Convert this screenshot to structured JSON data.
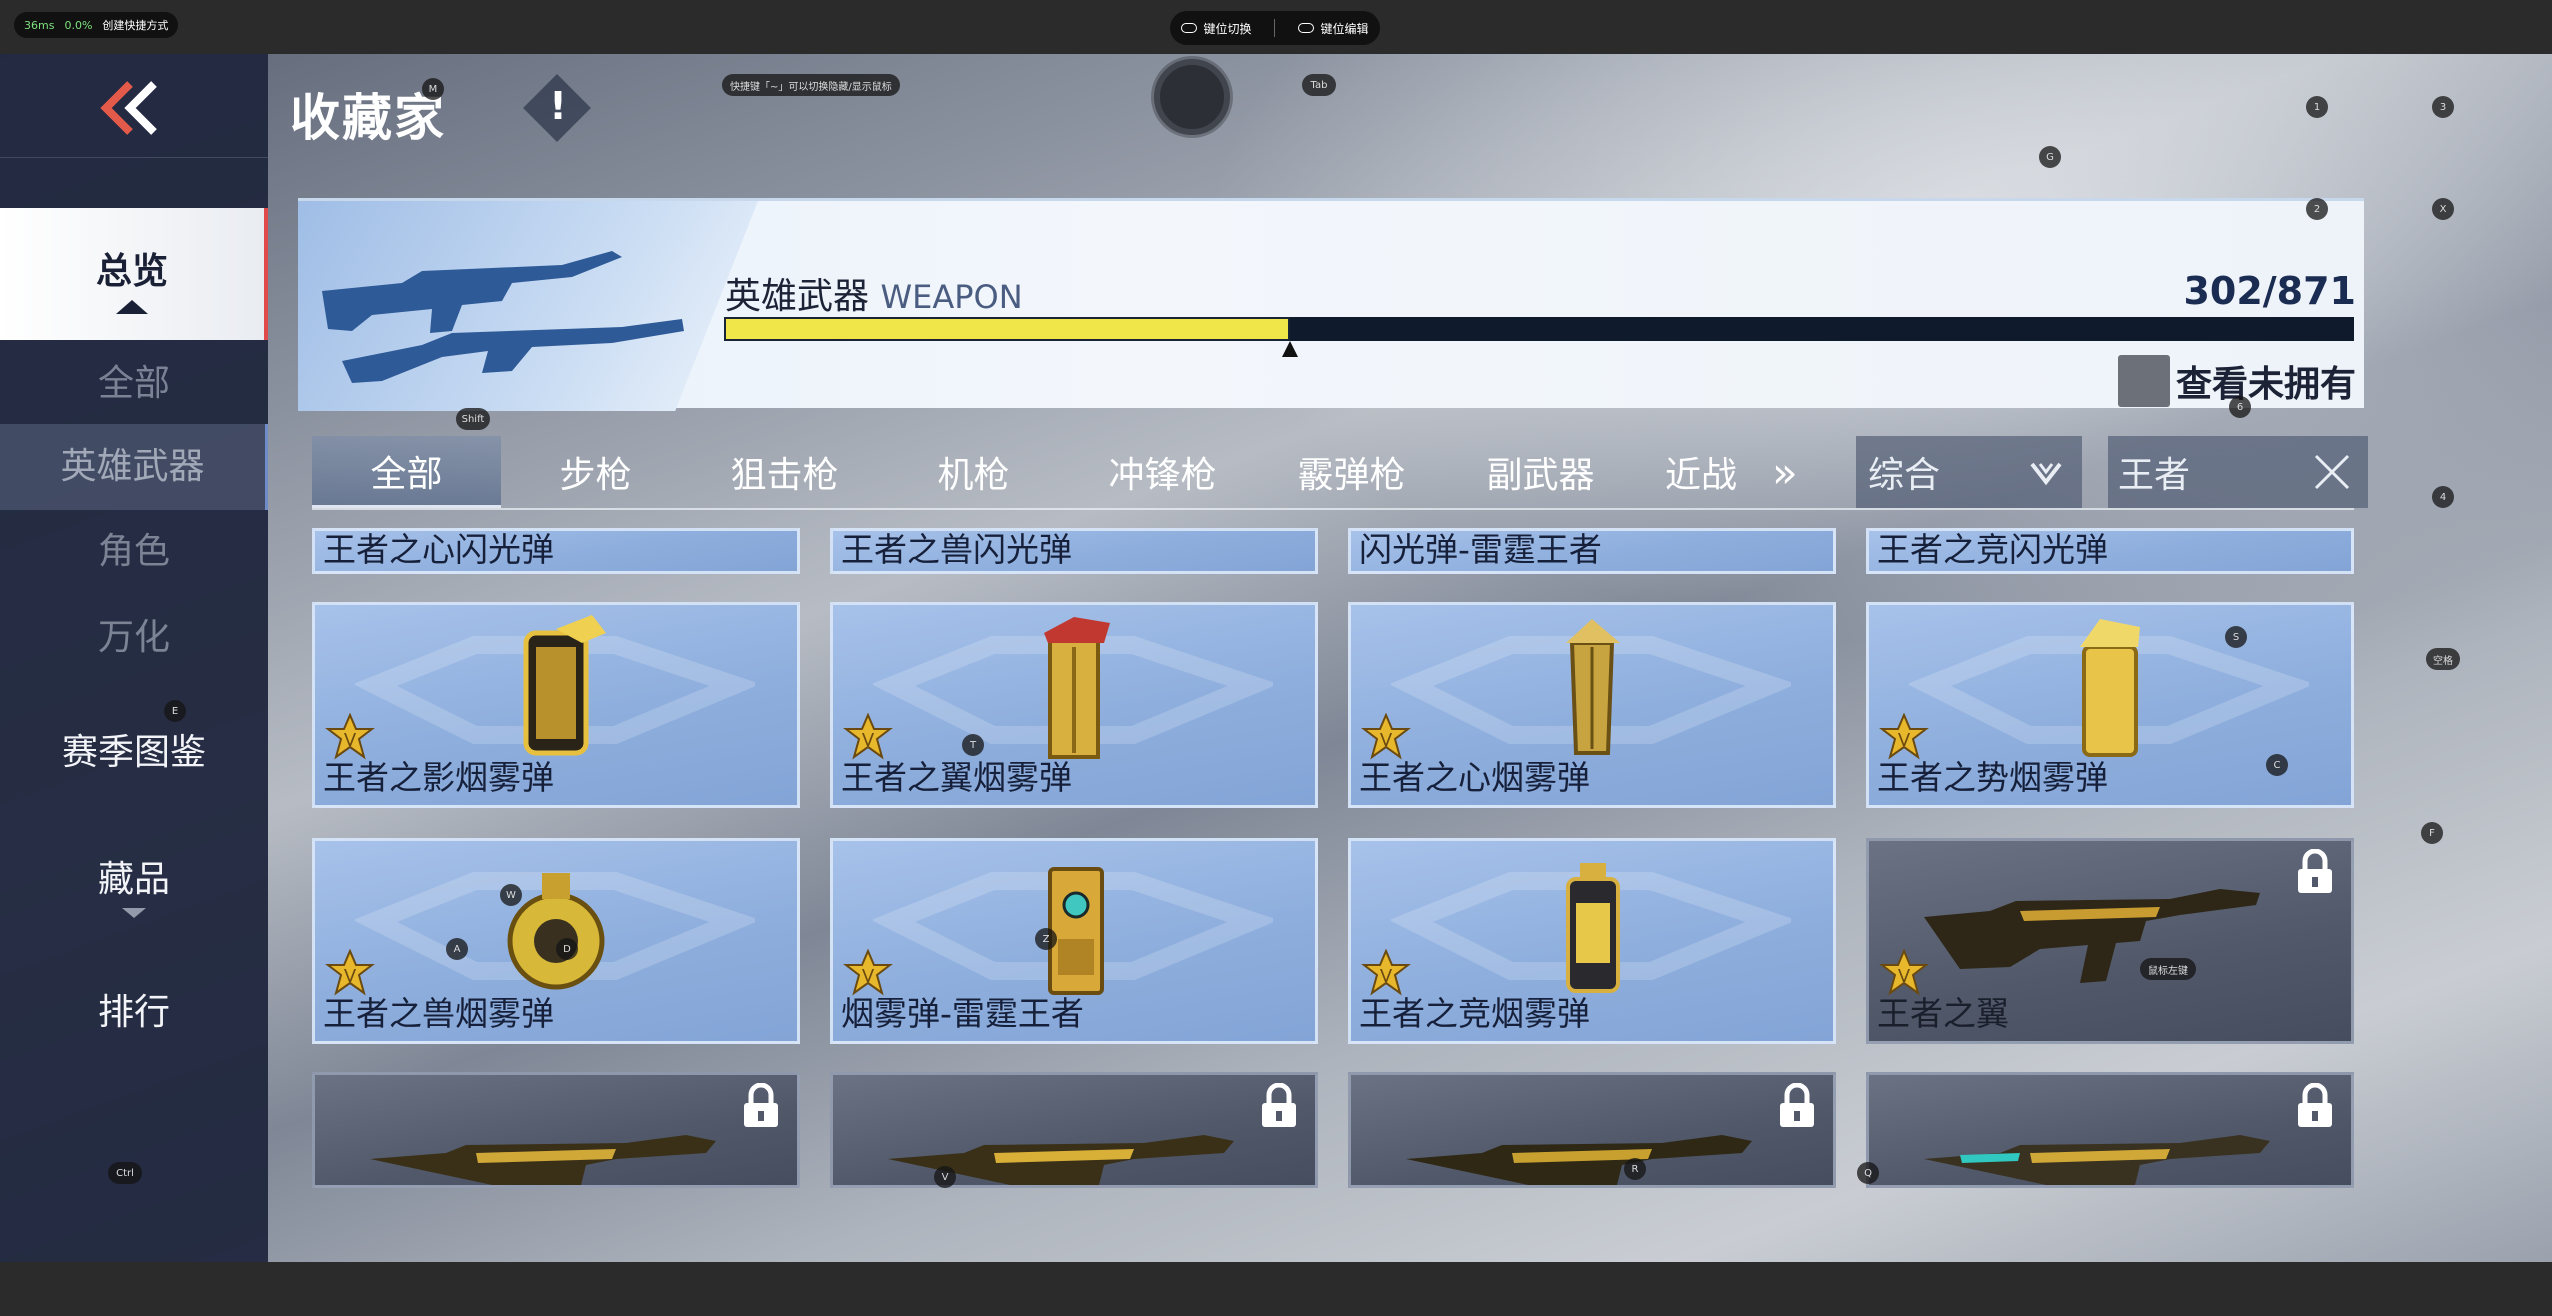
{
  "emulator": {
    "fps_ms": "36ms",
    "cpu": "0.0%",
    "shortcut_label": "创建快捷方式",
    "key_switch": "键位切换",
    "key_edit": "键位编辑"
  },
  "header": {
    "title": "收藏家",
    "info_symbol": "!",
    "hint_text": "快捷键「~」可以切换隐藏/显示鼠标"
  },
  "sidebar": {
    "items": [
      {
        "label": "总览",
        "state": "active"
      },
      {
        "label": "全部",
        "state": "sub"
      },
      {
        "label": "英雄武器",
        "state": "selected"
      },
      {
        "label": "角色",
        "state": "sub"
      },
      {
        "label": "万化",
        "state": "sub"
      },
      {
        "label": "赛季图鉴",
        "state": "normal"
      },
      {
        "label": "藏品",
        "state": "normal"
      },
      {
        "label": "排行",
        "state": "normal"
      }
    ]
  },
  "banner": {
    "label_cn": "英雄武器",
    "label_en": "WEAPON",
    "count": "302/871",
    "progress": 0.347,
    "unowned_label": "查看未拥有"
  },
  "tabs": {
    "items": [
      "全部",
      "步枪",
      "狙击枪",
      "机枪",
      "冲锋枪",
      "霰弹枪",
      "副武器",
      "近战"
    ],
    "active_index": 0,
    "more_symbol": "»"
  },
  "filter": {
    "sort_value": "综合",
    "search_value": "王者"
  },
  "grid": {
    "top_row": [
      "王者之心闪光弹",
      "王者之兽闪光弹",
      "闪光弹-雷霆王者",
      "王者之竞闪光弹"
    ],
    "row1": [
      {
        "name": "王者之影烟雾弹",
        "locked": false
      },
      {
        "name": "王者之翼烟雾弹",
        "locked": false
      },
      {
        "name": "王者之心烟雾弹",
        "locked": false
      },
      {
        "name": "王者之势烟雾弹",
        "locked": false
      }
    ],
    "row2": [
      {
        "name": "王者之兽烟雾弹",
        "locked": false
      },
      {
        "name": "烟雾弹-雷霆王者",
        "locked": false
      },
      {
        "name": "王者之竞烟雾弹",
        "locked": false
      },
      {
        "name": "王者之翼",
        "locked": true
      }
    ],
    "row3_locked": [
      true,
      true,
      true,
      true
    ]
  },
  "key_hints": {
    "m": "M",
    "tab": "Tab",
    "g": "G",
    "k1": "1",
    "k2": "2",
    "k3": "3",
    "x": "X",
    "shift": "Shift",
    "k4": "4",
    "k6": "6",
    "e": "E",
    "t": "T",
    "s": "S",
    "c": "C",
    "space": "空格",
    "f": "F",
    "w": "W",
    "a": "A",
    "d": "D",
    "z": "Z",
    "mouse_left": "鼠标左键",
    "ctrl": "Ctrl",
    "v": "V",
    "r": "R",
    "q": "Q"
  },
  "colors": {
    "sidebar_bg": "#20283e",
    "active_accent": "#e04a4a",
    "progress_fill": "#f0e64a",
    "progress_track": "#0f1a2c",
    "card_blue": "#8eaedd",
    "card_locked": "#50586a",
    "badge_gold": "#e8b82c"
  },
  "icons": {
    "back": "double-chevron-left-icon",
    "info": "exclamation-icon",
    "sort": "chevron-down-icon",
    "search_clear": "close-icon",
    "lock": "lock-icon",
    "rank_badge": "king-badge-icon"
  }
}
